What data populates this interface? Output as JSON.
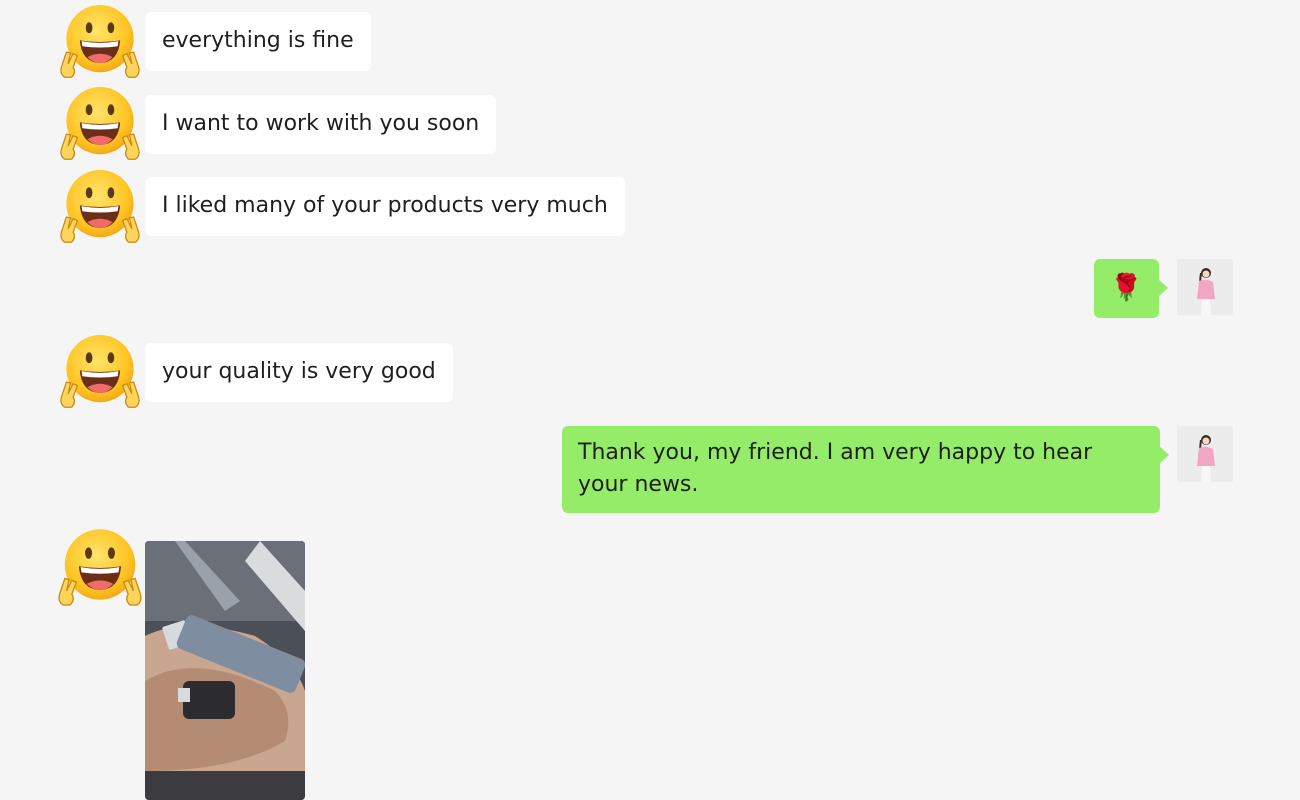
{
  "messages": {
    "m1": "everything is fine",
    "m2": "I want to work with you soon",
    "m3": "I liked many of your products very much",
    "m4": "🌹",
    "m5": "your quality is very good",
    "m6": "Thank you, my friend. I am very happy to hear your news."
  },
  "icons": {
    "contact_avatar": "grinning-peace-emoji-icon",
    "user_avatar": "profile-photo-icon",
    "rose": "rose-emoji-icon"
  },
  "colors": {
    "background": "#f5f5f5",
    "incoming_bubble": "#ffffff",
    "outgoing_bubble": "#95ec69"
  }
}
